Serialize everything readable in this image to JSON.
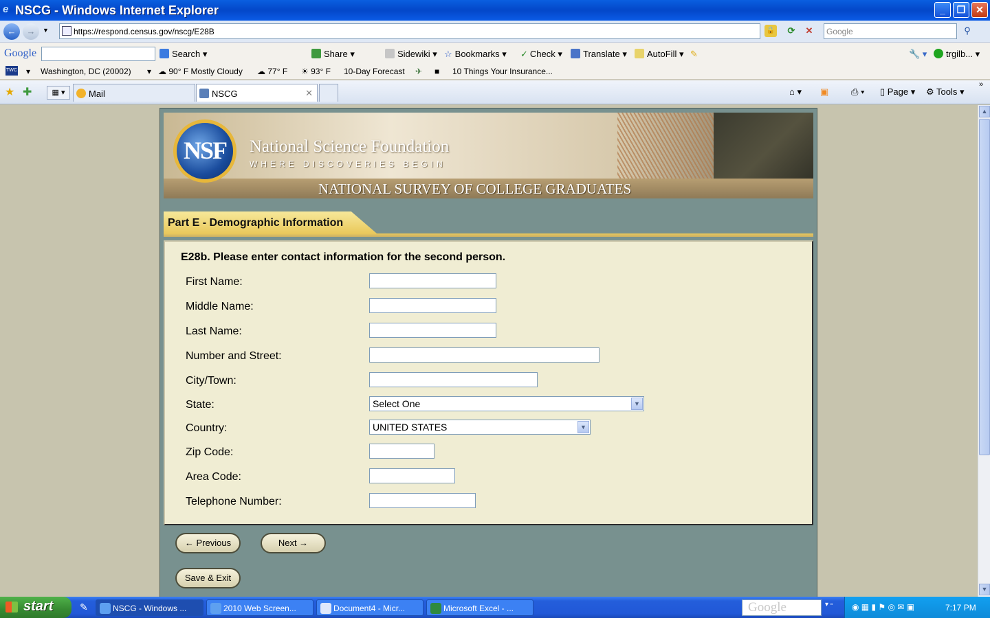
{
  "window": {
    "title": "NSCG - Windows Internet Explorer",
    "minimize": "_",
    "maximize": "❐",
    "close": "✕"
  },
  "address": {
    "url": "https://respond.census.gov/nscg/E28B",
    "search_placeholder": "Google"
  },
  "google_toolbar": {
    "logo": "Google",
    "items": {
      "search": "Search",
      "share": "Share",
      "sidewiki": "Sidewiki",
      "bookmarks": "Bookmarks",
      "check": "Check",
      "translate": "Translate",
      "autofill": "AutoFill",
      "account": "trgilb..."
    }
  },
  "weather_toolbar": {
    "twc": "TWC",
    "location": "Washington, DC (20002)",
    "current": "90° F Mostly Cloudy",
    "temp1": "77° F",
    "temp2": "93° F",
    "forecast": "10-Day Forecast",
    "news": "10 Things Your Insurance..."
  },
  "tabs": [
    {
      "label": "Mail"
    },
    {
      "label": "NSCG"
    }
  ],
  "commands": {
    "page": "Page",
    "tools": "Tools"
  },
  "banner": {
    "seal": "NSF",
    "org_name": "National Science Foundation",
    "tagline": "WHERE DISCOVERIES BEGIN",
    "survey_title": "NATIONAL SURVEY OF COLLEGE GRADUATES"
  },
  "section": {
    "title": "Part E - Demographic Information"
  },
  "form": {
    "question": "E28b. Please enter contact information for the second person.",
    "fields": {
      "first_name": "First Name:",
      "middle_name": "Middle Name:",
      "last_name": "Last Name:",
      "street": "Number and Street:",
      "city": "City/Town:",
      "state": "State:",
      "country": "Country:",
      "zip": "Zip Code:",
      "area_code": "Area Code:",
      "telephone": "Telephone Number:"
    },
    "state_value": "Select One",
    "country_value": "UNITED STATES"
  },
  "buttons": {
    "previous": "← Previous",
    "next": "Next →",
    "save_exit": "Save & Exit"
  },
  "taskbar": {
    "start": "start",
    "tasks": [
      {
        "label": "NSCG - Windows ..."
      },
      {
        "label": "2010 Web Screen..."
      },
      {
        "label": "Document4 - Micr..."
      },
      {
        "label": "Microsoft Excel - ..."
      }
    ],
    "google_box": "Google",
    "clock": "7:17 PM"
  }
}
